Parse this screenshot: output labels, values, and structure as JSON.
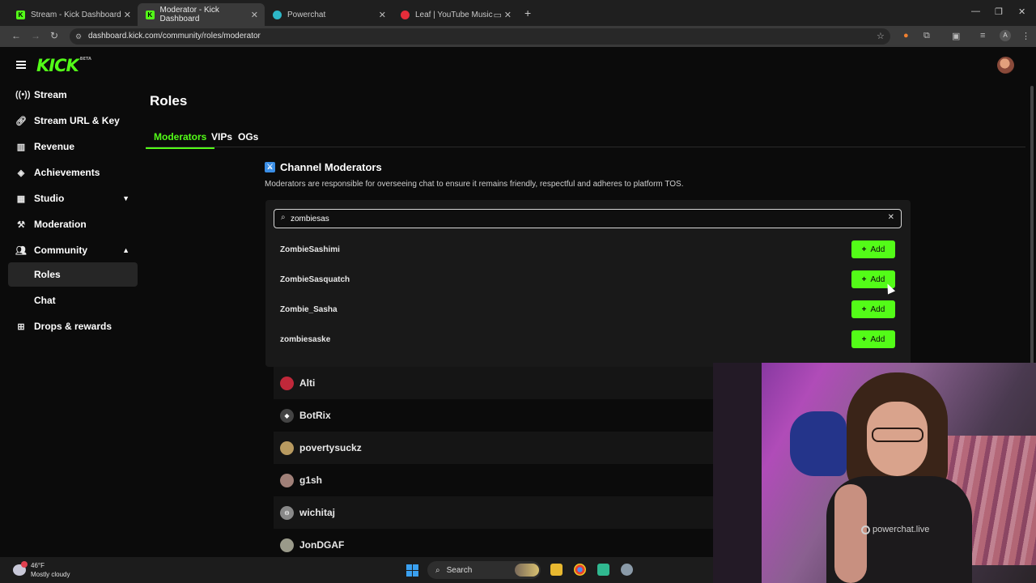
{
  "browser": {
    "tabs": [
      {
        "title": "Stream - Kick Dashboard",
        "favicon": "kick-icon"
      },
      {
        "title": "Moderator - Kick Dashboard",
        "favicon": "kick-icon",
        "active": true
      },
      {
        "title": "Powerchat",
        "favicon": "powerchat-icon"
      },
      {
        "title": "Leaf | YouTube Music",
        "favicon": "youtube-music-icon"
      }
    ],
    "url": "dashboard.kick.com/community/roles/moderator"
  },
  "app": {
    "logo": "KICK",
    "logo_badge": "BETA"
  },
  "sidebar": {
    "items": [
      {
        "label": "Stream",
        "icon": "broadcast-icon"
      },
      {
        "label": "Stream URL & Key",
        "icon": "key-icon"
      },
      {
        "label": "Revenue",
        "icon": "revenue-icon"
      },
      {
        "label": "Achievements",
        "icon": "trophy-icon"
      },
      {
        "label": "Studio",
        "icon": "studio-icon",
        "expandable": true
      },
      {
        "label": "Moderation",
        "icon": "hammer-icon"
      },
      {
        "label": "Community",
        "icon": "people-icon",
        "expanded": true
      },
      {
        "label": "Roles",
        "sub": true,
        "active": true
      },
      {
        "label": "Chat",
        "sub": true
      },
      {
        "label": "Drops & rewards",
        "icon": "gift-icon"
      }
    ]
  },
  "page": {
    "title": "Roles",
    "tabs": [
      "Moderators",
      "VIPs",
      "OGs"
    ],
    "active_tab": "Moderators",
    "section_title": "Channel Moderators",
    "section_desc": "Moderators are responsible for overseeing chat to ensure it remains friendly, respectful and adheres to platform TOS."
  },
  "search": {
    "value": "zombiesas",
    "results": [
      "ZombieSashimi",
      "ZombieSasquatch",
      "Zombie_Sasha",
      "zombiesaske"
    ],
    "add_label": "Add"
  },
  "moderators": [
    "Alti",
    "BotRix",
    "povertysuckz",
    "g1sh",
    "wichitaj",
    "JonDGAF"
  ],
  "webcam": {
    "shirt_text": "powerchat.live"
  },
  "taskbar": {
    "temp": "46°F",
    "weather": "Mostly cloudy",
    "search_label": "Search"
  },
  "colors": {
    "accent": "#53fc18",
    "background": "#0b0b0b",
    "panel": "#191919"
  }
}
